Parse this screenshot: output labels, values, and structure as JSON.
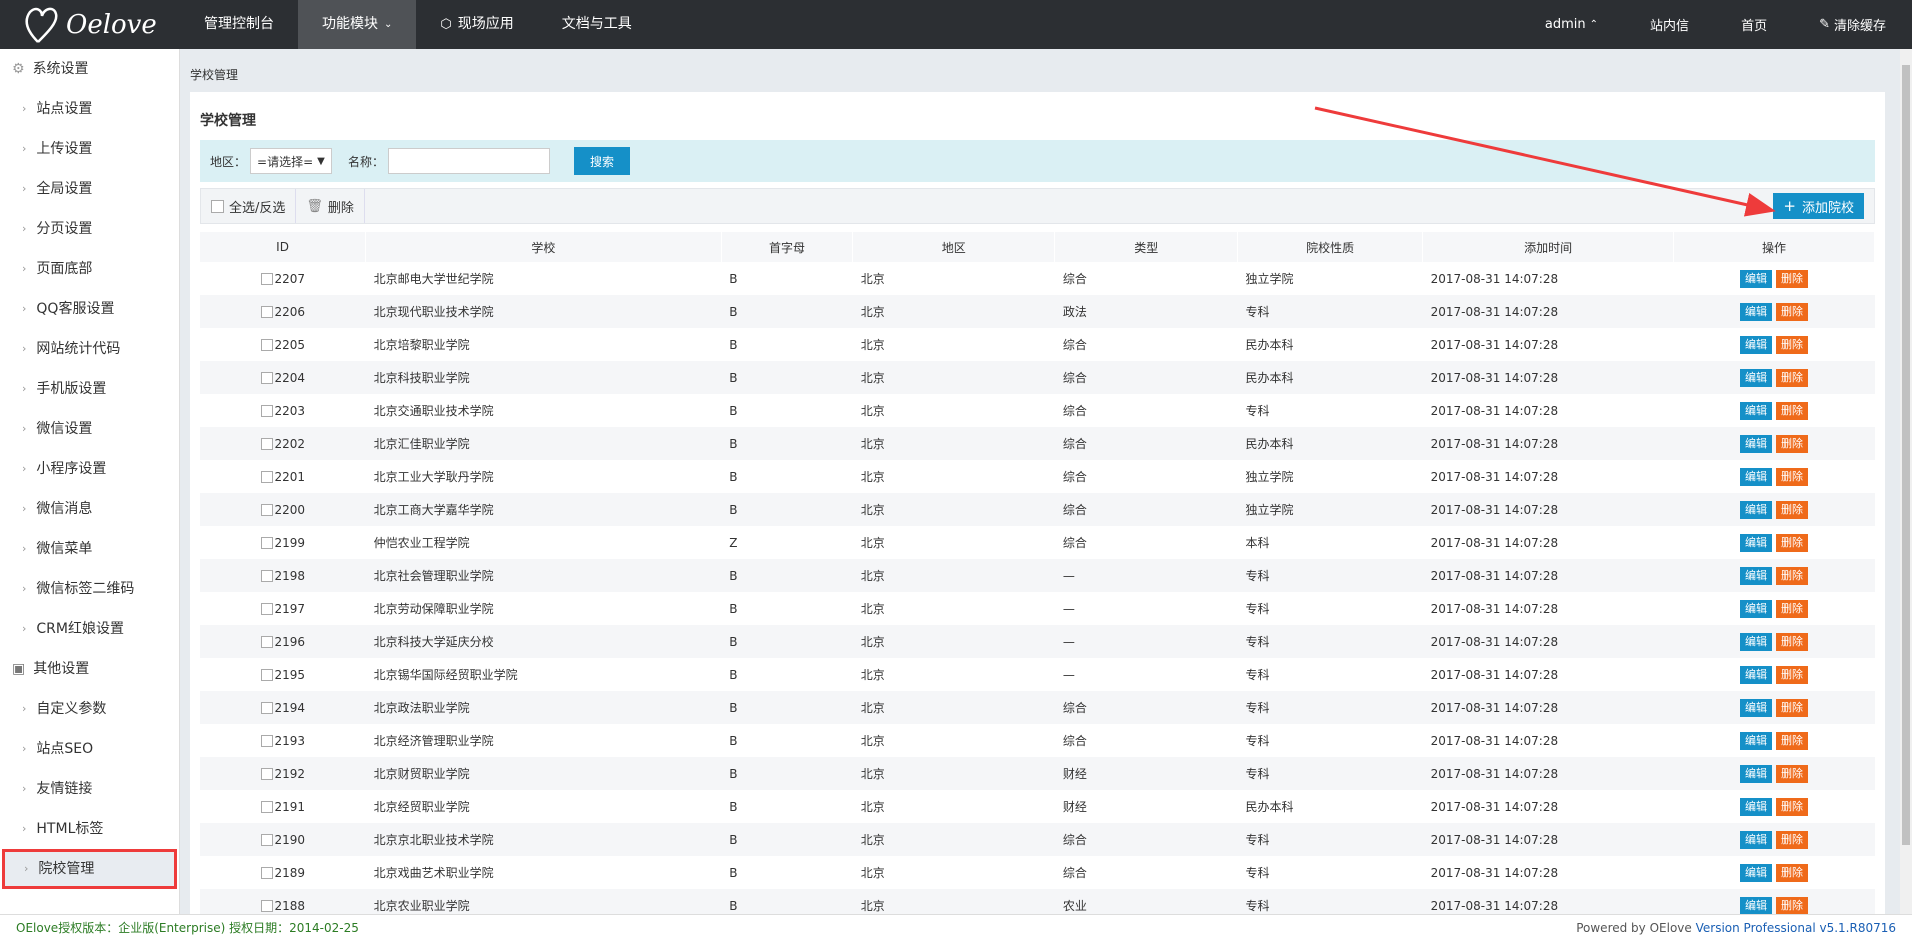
{
  "header": {
    "logo_text": "Oelove",
    "nav": [
      {
        "label": "管理控制台",
        "icon": ""
      },
      {
        "label": "功能模块",
        "icon": "chevron-down-icon"
      },
      {
        "label": "现场应用",
        "icon": "cube-icon"
      },
      {
        "label": "文档与工具",
        "icon": ""
      }
    ],
    "right": [
      {
        "label": "admin"
      },
      {
        "label": "站内信"
      },
      {
        "label": "首页"
      },
      {
        "label": "清除缓存"
      }
    ]
  },
  "sidebar": {
    "group1": "系统设置",
    "group1_items": [
      "站点设置",
      "上传设置",
      "全局设置",
      "分页设置",
      "页面底部",
      "QQ客服设置",
      "网站统计代码",
      "手机版设置",
      "微信设置",
      "小程序设置",
      "微信消息",
      "微信菜单",
      "微信标签二维码",
      "CRM红娘设置"
    ],
    "group2": "其他设置",
    "group2_items": [
      "自定义参数",
      "站点SEO",
      "友情链接",
      "HTML标签",
      "院校管理"
    ]
  },
  "breadcrumb": "学校管理",
  "panel": {
    "title": "学校管理",
    "search": {
      "region_label": "地区：",
      "region_value": "=请选择=",
      "name_label": "名称：",
      "name_value": "",
      "search_button": "搜索"
    },
    "toolbar": {
      "select_all": "全选/反选",
      "delete": "删除",
      "add_button": "添加院校"
    },
    "columns": [
      "ID",
      "学校",
      "首字母",
      "地区",
      "类型",
      "院校性质",
      "添加时间",
      "操作"
    ],
    "edit_label": "编辑",
    "delete_label": "删除",
    "rows": [
      {
        "id": "2207",
        "name": "北京邮电大学世纪学院",
        "initial": "B",
        "region": "北京",
        "type": "综合",
        "nature": "独立学院",
        "time": "2017-08-31 14:07:28"
      },
      {
        "id": "2206",
        "name": "北京现代职业技术学院",
        "initial": "B",
        "region": "北京",
        "type": "政法",
        "nature": "专科",
        "time": "2017-08-31 14:07:28"
      },
      {
        "id": "2205",
        "name": "北京培黎职业学院",
        "initial": "B",
        "region": "北京",
        "type": "综合",
        "nature": "民办本科",
        "time": "2017-08-31 14:07:28"
      },
      {
        "id": "2204",
        "name": "北京科技职业学院",
        "initial": "B",
        "region": "北京",
        "type": "综合",
        "nature": "民办本科",
        "time": "2017-08-31 14:07:28"
      },
      {
        "id": "2203",
        "name": "北京交通职业技术学院",
        "initial": "B",
        "region": "北京",
        "type": "综合",
        "nature": "专科",
        "time": "2017-08-31 14:07:28"
      },
      {
        "id": "2202",
        "name": "北京汇佳职业学院",
        "initial": "B",
        "region": "北京",
        "type": "综合",
        "nature": "民办本科",
        "time": "2017-08-31 14:07:28"
      },
      {
        "id": "2201",
        "name": "北京工业大学耿丹学院",
        "initial": "B",
        "region": "北京",
        "type": "综合",
        "nature": "独立学院",
        "time": "2017-08-31 14:07:28"
      },
      {
        "id": "2200",
        "name": "北京工商大学嘉华学院",
        "initial": "B",
        "region": "北京",
        "type": "综合",
        "nature": "独立学院",
        "time": "2017-08-31 14:07:28"
      },
      {
        "id": "2199",
        "name": "仲恺农业工程学院",
        "initial": "Z",
        "region": "北京",
        "type": "综合",
        "nature": "本科",
        "time": "2017-08-31 14:07:28"
      },
      {
        "id": "2198",
        "name": "北京社会管理职业学院",
        "initial": "B",
        "region": "北京",
        "type": "—",
        "nature": "专科",
        "time": "2017-08-31 14:07:28"
      },
      {
        "id": "2197",
        "name": "北京劳动保障职业学院",
        "initial": "B",
        "region": "北京",
        "type": "—",
        "nature": "专科",
        "time": "2017-08-31 14:07:28"
      },
      {
        "id": "2196",
        "name": "北京科技大学延庆分校",
        "initial": "B",
        "region": "北京",
        "type": "—",
        "nature": "专科",
        "time": "2017-08-31 14:07:28"
      },
      {
        "id": "2195",
        "name": "北京锡华国际经贸职业学院",
        "initial": "B",
        "region": "北京",
        "type": "—",
        "nature": "专科",
        "time": "2017-08-31 14:07:28"
      },
      {
        "id": "2194",
        "name": "北京政法职业学院",
        "initial": "B",
        "region": "北京",
        "type": "综合",
        "nature": "专科",
        "time": "2017-08-31 14:07:28"
      },
      {
        "id": "2193",
        "name": "北京经济管理职业学院",
        "initial": "B",
        "region": "北京",
        "type": "综合",
        "nature": "专科",
        "time": "2017-08-31 14:07:28"
      },
      {
        "id": "2192",
        "name": "北京财贸职业学院",
        "initial": "B",
        "region": "北京",
        "type": "财经",
        "nature": "专科",
        "time": "2017-08-31 14:07:28"
      },
      {
        "id": "2191",
        "name": "北京经贸职业学院",
        "initial": "B",
        "region": "北京",
        "type": "财经",
        "nature": "民办本科",
        "time": "2017-08-31 14:07:28"
      },
      {
        "id": "2190",
        "name": "北京京北职业技术学院",
        "initial": "B",
        "region": "北京",
        "type": "综合",
        "nature": "专科",
        "time": "2017-08-31 14:07:28"
      },
      {
        "id": "2189",
        "name": "北京戏曲艺术职业学院",
        "initial": "B",
        "region": "北京",
        "type": "综合",
        "nature": "专科",
        "time": "2017-08-31 14:07:28"
      },
      {
        "id": "2188",
        "name": "北京农业职业学院",
        "initial": "B",
        "region": "北京",
        "type": "农业",
        "nature": "专科",
        "time": "2017-08-31 14:07:28"
      }
    ]
  },
  "footer": {
    "license": "OElove授权版本：企业版(Enterprise) 授权日期：2014-02-25",
    "powered": "Powered by OElove",
    "version": "Version Professional v5.1.R80716"
  },
  "colors": {
    "primary": "#1590c8",
    "danger": "#ef6a1a",
    "topbar": "#2c2f33",
    "highlight": "#ee3b3b"
  }
}
